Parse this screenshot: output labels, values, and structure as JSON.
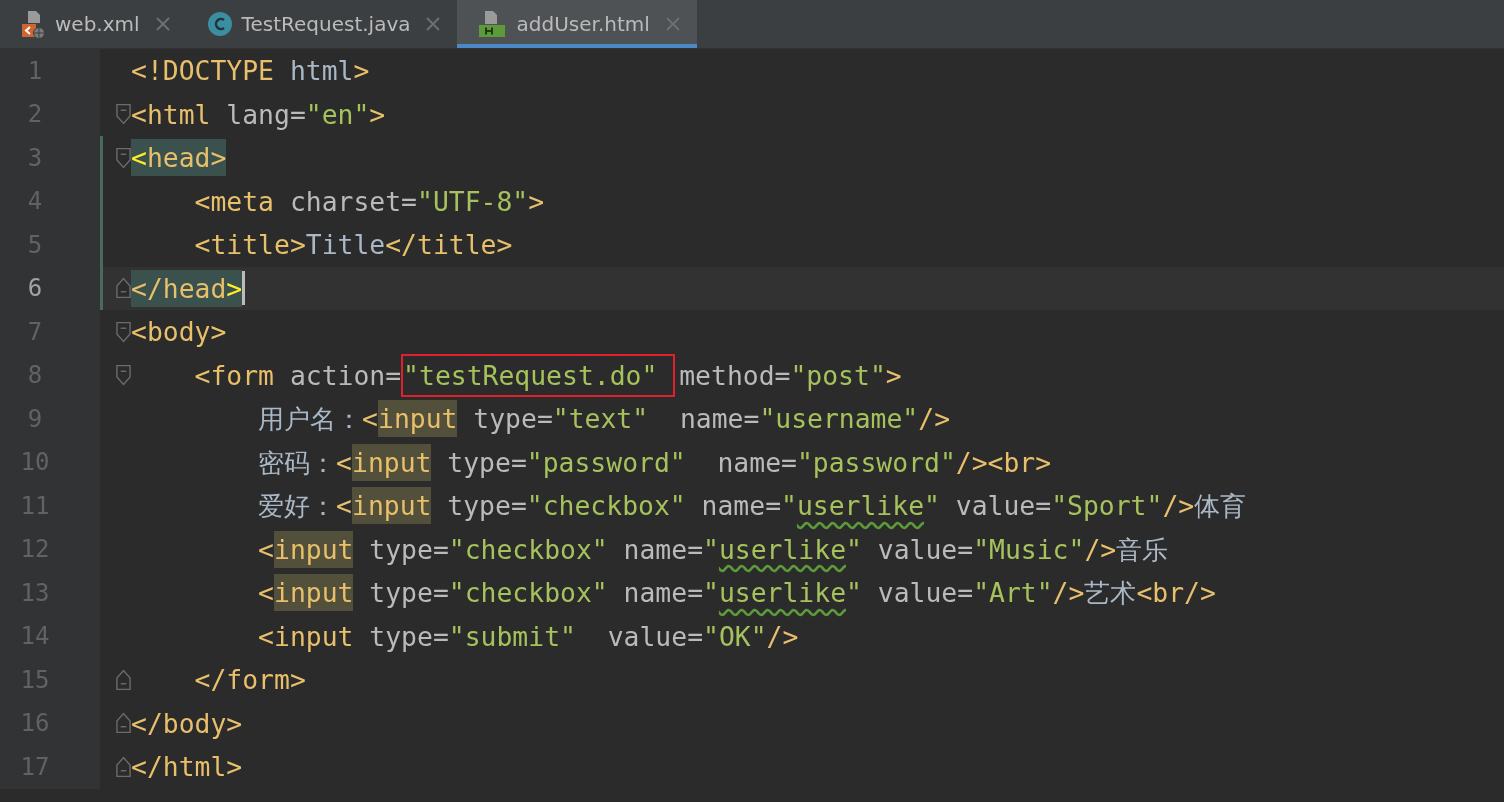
{
  "tabs": [
    {
      "label": "web.xml",
      "kind": "xml",
      "selected": false
    },
    {
      "label": "TestRequest.java",
      "kind": "class",
      "selected": false
    },
    {
      "label": "addUser.html",
      "kind": "html",
      "selected": true
    }
  ],
  "editor": {
    "lines": [
      {
        "number": "1",
        "current": false,
        "changed": false,
        "fold_open": false,
        "fold_close": false,
        "tokens": [
          {
            "kind": "tag",
            "t": "<!DOCTYPE"
          },
          {
            "kind": "text",
            "t": " html"
          },
          {
            "kind": "tag",
            "t": ">"
          }
        ]
      },
      {
        "number": "2",
        "current": false,
        "changed": false,
        "fold_open": true,
        "fold_close": false,
        "tokens": [
          {
            "kind": "tag",
            "t": "<html"
          },
          {
            "kind": "attr",
            "t": " lang="
          },
          {
            "kind": "str",
            "t": "\"en\""
          },
          {
            "kind": "tag",
            "t": ">"
          }
        ]
      },
      {
        "number": "3",
        "current": false,
        "changed": true,
        "fold_open": true,
        "fold_close": false,
        "tokens": [
          {
            "kind": "brace",
            "t": "<",
            "matched": true
          },
          {
            "kind": "tag",
            "t": "head>",
            "matched": true
          }
        ]
      },
      {
        "number": "4",
        "current": false,
        "changed": true,
        "fold_open": false,
        "fold_close": false,
        "tokens": [
          {
            "kind": "tag",
            "t": "    <meta"
          },
          {
            "kind": "attr",
            "t": " charset="
          },
          {
            "kind": "str",
            "t": "\"UTF-8\""
          },
          {
            "kind": "tag",
            "t": ">"
          }
        ]
      },
      {
        "number": "5",
        "current": false,
        "changed": true,
        "fold_open": false,
        "fold_close": false,
        "tokens": [
          {
            "kind": "tag",
            "t": "    <title>"
          },
          {
            "kind": "text",
            "t": "Title"
          },
          {
            "kind": "tag",
            "t": "</title>"
          }
        ]
      },
      {
        "number": "6",
        "current": true,
        "changed": true,
        "fold_open": false,
        "fold_close": true,
        "tokens": [
          {
            "kind": "tag",
            "t": "</head",
            "matched": true
          },
          {
            "kind": "brace",
            "t": ">",
            "matched": true
          }
        ]
      },
      {
        "number": "7",
        "current": false,
        "changed": false,
        "fold_open": true,
        "fold_close": false,
        "tokens": [
          {
            "kind": "tag",
            "t": "<body>"
          }
        ]
      },
      {
        "number": "8",
        "current": false,
        "changed": false,
        "fold_open": true,
        "fold_close": false,
        "tokens": [
          {
            "kind": "tag",
            "t": "    <form"
          },
          {
            "kind": "attr",
            "t": " action="
          },
          {
            "kind": "str",
            "t": "\"testRequest.do\" ",
            "boxed": true
          },
          {
            "kind": "attr",
            "t": "method="
          },
          {
            "kind": "str",
            "t": "\"post\""
          },
          {
            "kind": "tag",
            "t": ">"
          }
        ]
      },
      {
        "number": "9",
        "current": false,
        "changed": false,
        "fold_open": false,
        "fold_close": false,
        "tokens": [
          {
            "kind": "text",
            "t": "        用户名："
          },
          {
            "kind": "tag",
            "t": "<"
          },
          {
            "kind": "tag",
            "t": "input",
            "usage": true
          },
          {
            "kind": "attr",
            "t": " type="
          },
          {
            "kind": "str",
            "t": "\"text\""
          },
          {
            "kind": "attr",
            "t": "  name="
          },
          {
            "kind": "str",
            "t": "\"username\""
          },
          {
            "kind": "tag",
            "t": "/>"
          }
        ]
      },
      {
        "number": "10",
        "current": false,
        "changed": false,
        "fold_open": false,
        "fold_close": false,
        "tokens": [
          {
            "kind": "text",
            "t": "        密码："
          },
          {
            "kind": "tag",
            "t": "<"
          },
          {
            "kind": "tag",
            "t": "input",
            "usage": true
          },
          {
            "kind": "attr",
            "t": " type="
          },
          {
            "kind": "str",
            "t": "\"password\""
          },
          {
            "kind": "attr",
            "t": "  name="
          },
          {
            "kind": "str",
            "t": "\"password\""
          },
          {
            "kind": "tag",
            "t": "/><br>"
          }
        ]
      },
      {
        "number": "11",
        "current": false,
        "changed": false,
        "fold_open": false,
        "fold_close": false,
        "tokens": [
          {
            "kind": "text",
            "t": "        爱好："
          },
          {
            "kind": "tag",
            "t": "<"
          },
          {
            "kind": "tag",
            "t": "input",
            "usage": true
          },
          {
            "kind": "attr",
            "t": " type="
          },
          {
            "kind": "str",
            "t": "\"checkbox\""
          },
          {
            "kind": "attr",
            "t": " name="
          },
          {
            "kind": "str",
            "t": "\""
          },
          {
            "kind": "str",
            "t": "userlike",
            "typo": true
          },
          {
            "kind": "str",
            "t": "\""
          },
          {
            "kind": "attr",
            "t": " value="
          },
          {
            "kind": "str",
            "t": "\"Sport\""
          },
          {
            "kind": "tag",
            "t": "/>"
          },
          {
            "kind": "text",
            "t": "体育"
          }
        ]
      },
      {
        "number": "12",
        "current": false,
        "changed": false,
        "fold_open": false,
        "fold_close": false,
        "tokens": [
          {
            "kind": "tag",
            "t": "        <"
          },
          {
            "kind": "tag",
            "t": "input",
            "usage": true
          },
          {
            "kind": "attr",
            "t": " type="
          },
          {
            "kind": "str",
            "t": "\"checkbox\""
          },
          {
            "kind": "attr",
            "t": " name="
          },
          {
            "kind": "str",
            "t": "\""
          },
          {
            "kind": "str",
            "t": "userlike",
            "typo": true
          },
          {
            "kind": "str",
            "t": "\""
          },
          {
            "kind": "attr",
            "t": " value="
          },
          {
            "kind": "str",
            "t": "\"Music\""
          },
          {
            "kind": "tag",
            "t": "/>"
          },
          {
            "kind": "text",
            "t": "音乐"
          }
        ]
      },
      {
        "number": "13",
        "current": false,
        "changed": false,
        "fold_open": false,
        "fold_close": false,
        "tokens": [
          {
            "kind": "tag",
            "t": "        <"
          },
          {
            "kind": "tag",
            "t": "input",
            "usage": true
          },
          {
            "kind": "attr",
            "t": " type="
          },
          {
            "kind": "str",
            "t": "\"checkbox\""
          },
          {
            "kind": "attr",
            "t": " name="
          },
          {
            "kind": "str",
            "t": "\""
          },
          {
            "kind": "str",
            "t": "userlike",
            "typo": true
          },
          {
            "kind": "str",
            "t": "\""
          },
          {
            "kind": "attr",
            "t": " value="
          },
          {
            "kind": "str",
            "t": "\"Art\""
          },
          {
            "kind": "tag",
            "t": "/>"
          },
          {
            "kind": "text",
            "t": "艺术"
          },
          {
            "kind": "tag",
            "t": "<br/>"
          }
        ]
      },
      {
        "number": "14",
        "current": false,
        "changed": false,
        "fold_open": false,
        "fold_close": false,
        "tokens": [
          {
            "kind": "tag",
            "t": "        <input"
          },
          {
            "kind": "attr",
            "t": " type="
          },
          {
            "kind": "str",
            "t": "\"submit\""
          },
          {
            "kind": "attr",
            "t": "  value="
          },
          {
            "kind": "str",
            "t": "\"OK\""
          },
          {
            "kind": "tag",
            "t": "/>"
          }
        ]
      },
      {
        "number": "15",
        "current": false,
        "changed": false,
        "fold_open": false,
        "fold_close": true,
        "tokens": [
          {
            "kind": "tag",
            "t": "    </form>"
          }
        ]
      },
      {
        "number": "16",
        "current": false,
        "changed": false,
        "fold_open": false,
        "fold_close": true,
        "tokens": [
          {
            "kind": "tag",
            "t": "</body>"
          }
        ]
      },
      {
        "number": "17",
        "current": false,
        "changed": false,
        "fold_open": false,
        "fold_close": true,
        "tokens": [
          {
            "kind": "tag",
            "t": "</html>"
          }
        ]
      }
    ]
  }
}
